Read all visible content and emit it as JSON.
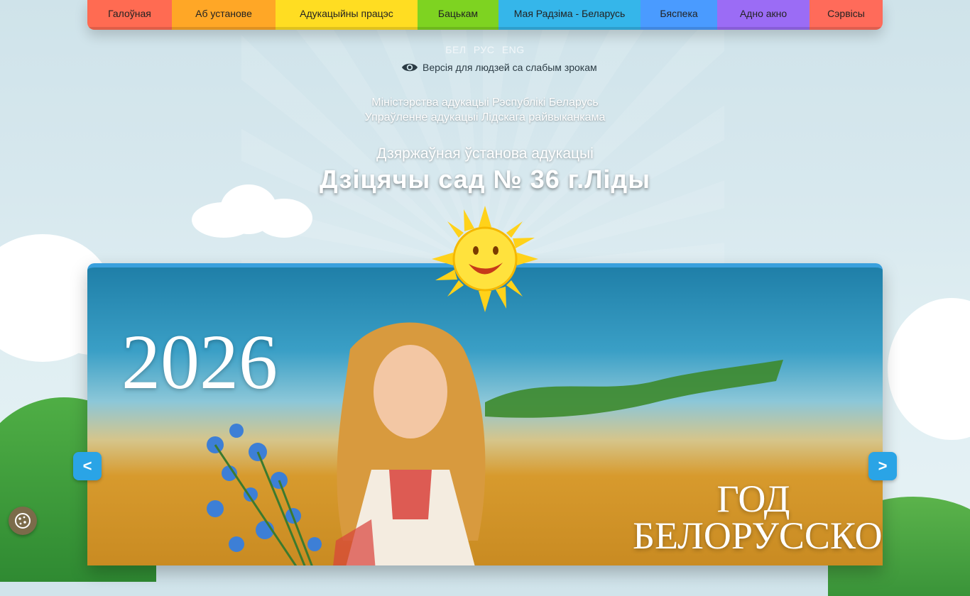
{
  "nav": {
    "items": [
      {
        "label": "Галоўная",
        "color": "#ff6b52"
      },
      {
        "label": "Аб установе",
        "color": "#ffa726"
      },
      {
        "label": "Адукацыйны працэс",
        "color": "#ffdd22"
      },
      {
        "label": "Бацькам",
        "color": "#7ed321"
      },
      {
        "label": "Мая Радзіма - Беларусь",
        "color": "#35b6ea"
      },
      {
        "label": "Бяспека",
        "color": "#4a9bff"
      },
      {
        "label": "Адно акно",
        "color": "#9b6cf5"
      },
      {
        "label": "Сэрвісы",
        "color": "#ff6b5a"
      }
    ]
  },
  "lang": {
    "be": "БЕЛ",
    "ru": "РУС",
    "en": "ENG"
  },
  "accessibility": {
    "low_vision_label": "Версія для людзей са слабым зрокам",
    "icon": "eye-icon"
  },
  "header": {
    "ministry_line1": "Міністэрства адукацыі Рэспублікі Беларусь",
    "ministry_line2": "Упраўленне адукацыі Лідскага райвыканкама",
    "org_type": "Дзяржаўная ўстанова адукацыі",
    "org_name": "Дзіцячы сад № 36 г.Ліды"
  },
  "slider": {
    "year": "2026",
    "caption_line1": "ГОД",
    "caption_line2": "БЕЛОРУССКОЙ",
    "prev_label": "<",
    "next_label": ">"
  },
  "cookie": {
    "icon": "cookie-icon"
  },
  "colors": {
    "accent": "#2aa4e6",
    "slider_border": "#3aa0dd"
  }
}
